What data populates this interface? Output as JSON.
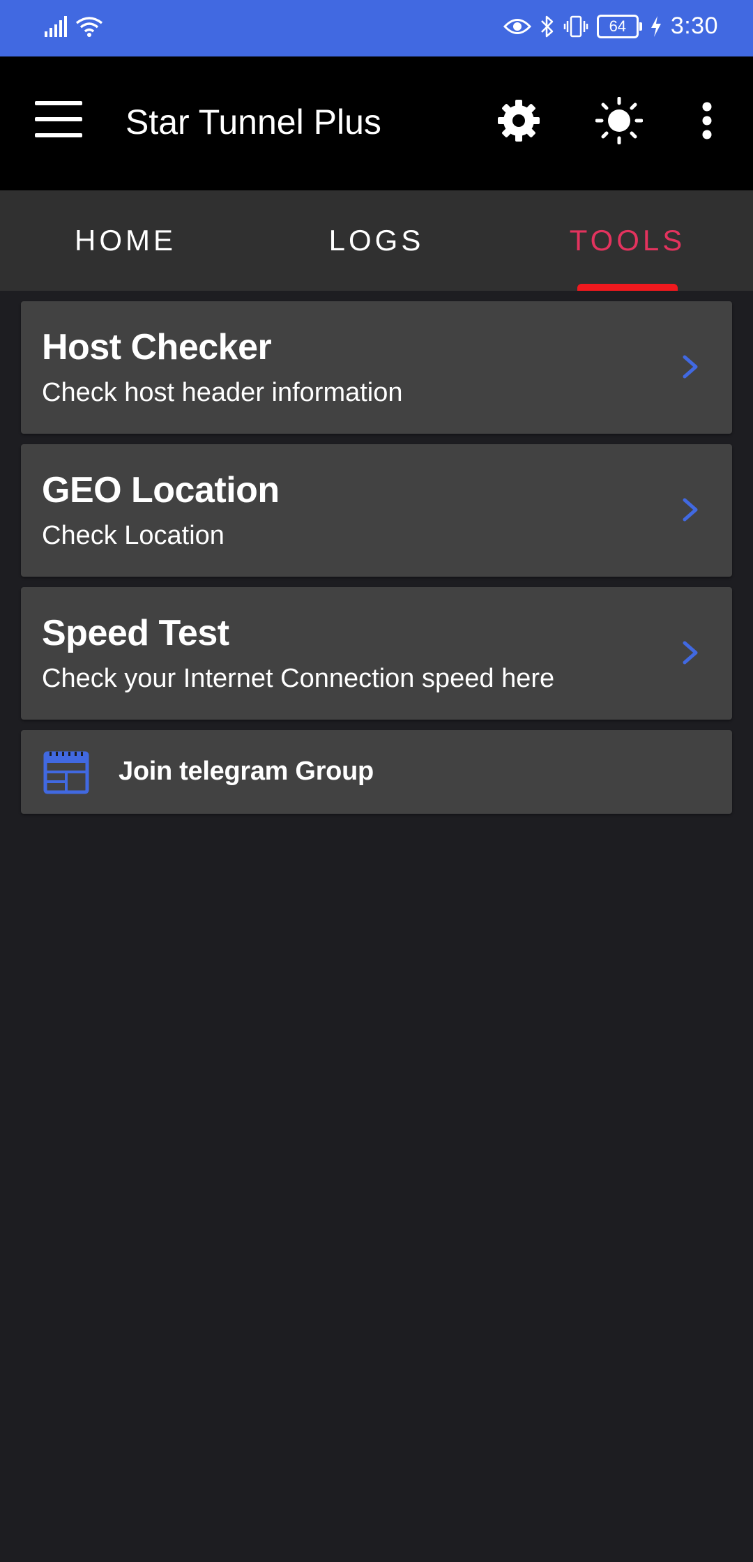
{
  "status_bar": {
    "time": "3:30",
    "battery_level": "64",
    "icons": [
      "signal-icon",
      "wifi-icon",
      "eye-icon",
      "bluetooth-icon",
      "vibrate-icon",
      "battery-icon",
      "charging-icon"
    ]
  },
  "app_bar": {
    "title": "Star Tunnel Plus",
    "icons": [
      "menu-icon",
      "settings-icon",
      "brightness-icon",
      "more-vert-icon"
    ]
  },
  "tabs": [
    {
      "label": "HOME",
      "active": false
    },
    {
      "label": "LOGS",
      "active": false
    },
    {
      "label": "TOOLS",
      "active": true
    }
  ],
  "tools": [
    {
      "title": "Host Checker",
      "subtitle": "Check host header information"
    },
    {
      "title": "GEO Location",
      "subtitle": "Check Location"
    },
    {
      "title": "Speed Test",
      "subtitle": "Check your Internet Connection speed here"
    }
  ],
  "telegram": {
    "label": "Join telegram Group",
    "icon": "web-layout-icon"
  },
  "colors": {
    "status_bar": "#4169e1",
    "app_bar": "#000000",
    "tab_bar": "#303030",
    "background": "#1d1d21",
    "card": "#424242",
    "active_tab_text": "#e3335e",
    "tab_indicator": "#f0191e",
    "accent_blue": "#4169e1"
  }
}
